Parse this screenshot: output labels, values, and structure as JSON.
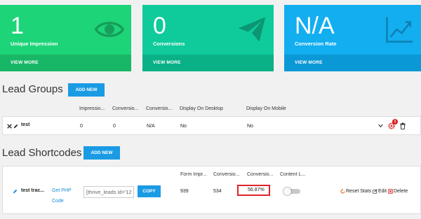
{
  "stats": [
    {
      "value": "1",
      "label": "Unique Impression",
      "more": "VIEW MORE",
      "icon": "eye-icon"
    },
    {
      "value": "0",
      "label": "Conversions",
      "more": "VIEW MORE",
      "icon": "paper-plane-icon"
    },
    {
      "value": "N/A",
      "label": "Conversion Rate",
      "more": "VIEW MORE",
      "icon": "trending-chart-icon"
    }
  ],
  "lead_groups": {
    "title": "Lead Groups",
    "add_new": "ADD NEW",
    "columns": [
      "Impressio...",
      "Conversio...",
      "Conversio...",
      "Display On Desktop",
      "Display On Mobile"
    ],
    "row": {
      "name": "test",
      "impressions": "0",
      "conversions": "0",
      "conversion_rate": "N/A",
      "desktop": "No",
      "mobile": "No",
      "badge": "1"
    }
  },
  "lead_shortcodes": {
    "title": "Lead Shortcodes",
    "add_new": "ADD NEW",
    "columns": [
      "Form Impr...",
      "Conversio...",
      "Conversio...",
      "Content L..."
    ],
    "row": {
      "name": "test trac...",
      "get_php": "Get PHP",
      "code": "Code",
      "shortcode_value": "[thrive_leads id='12",
      "copy": "COPY",
      "form_impressions": "939",
      "conversions": "534",
      "conversion_rate": "56.87%",
      "reset_stats": "Reset Stats",
      "edit": "Edit",
      "delete": "Delete"
    }
  },
  "colors": {
    "green": "#1ed479",
    "teal": "#0fcb9b",
    "blue": "#12aef0",
    "button": "#1a9be4",
    "highlight": "#e0242a"
  }
}
